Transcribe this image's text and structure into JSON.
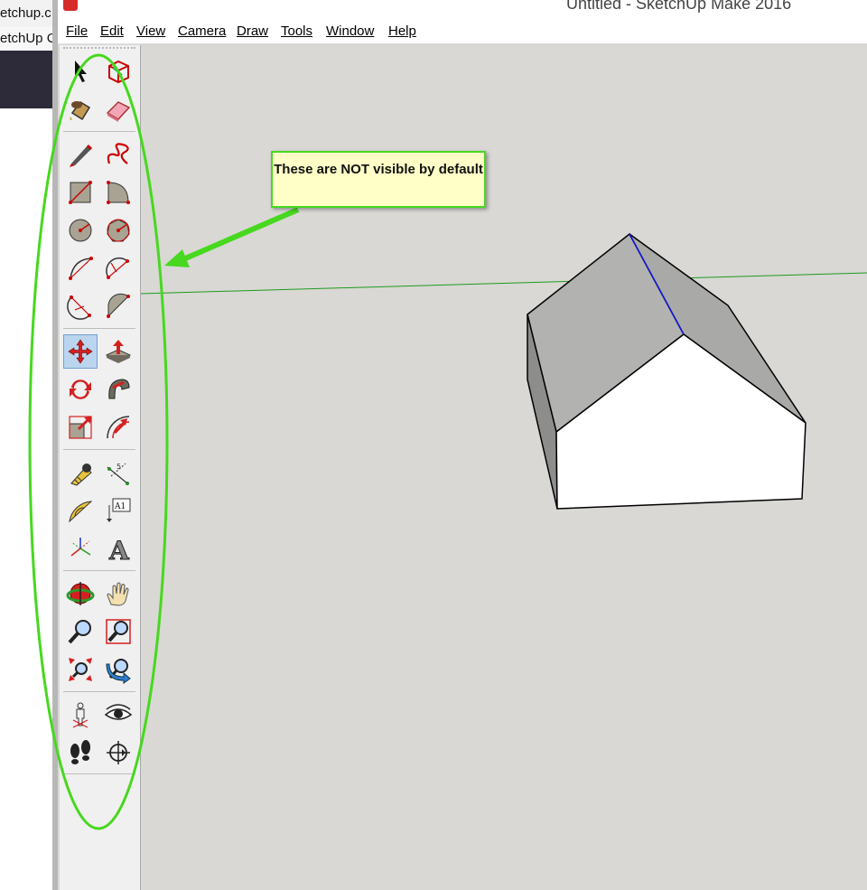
{
  "background_browser": {
    "tab_text": "etchup.c",
    "tab2_text": "etchUp C"
  },
  "window": {
    "title": "Untitled - SketchUp Make 2016"
  },
  "menu": [
    "File",
    "Edit",
    "View",
    "Camera",
    "Draw",
    "Tools",
    "Window",
    "Help"
  ],
  "toolbar": {
    "tools": [
      {
        "name": "select",
        "icon": "select-arrow-icon"
      },
      {
        "name": "make-component",
        "icon": "component-icon"
      },
      {
        "name": "paint-bucket",
        "icon": "paint-bucket-icon"
      },
      {
        "name": "eraser",
        "icon": "eraser-icon"
      },
      {
        "name": "line",
        "icon": "pencil-icon"
      },
      {
        "name": "freehand",
        "icon": "freehand-icon"
      },
      {
        "name": "rectangle",
        "icon": "rectangle-icon"
      },
      {
        "name": "rotated-rectangle",
        "icon": "rotated-rectangle-icon"
      },
      {
        "name": "circle",
        "icon": "circle-icon"
      },
      {
        "name": "polygon",
        "icon": "polygon-icon"
      },
      {
        "name": "arc",
        "icon": "arc-icon"
      },
      {
        "name": "two-point-arc",
        "icon": "two-point-arc-icon"
      },
      {
        "name": "three-point-arc",
        "icon": "three-point-arc-icon"
      },
      {
        "name": "pie",
        "icon": "pie-icon"
      },
      {
        "name": "move",
        "icon": "move-icon",
        "selected": true
      },
      {
        "name": "push-pull",
        "icon": "push-pull-icon"
      },
      {
        "name": "rotate",
        "icon": "rotate-icon"
      },
      {
        "name": "follow-me",
        "icon": "follow-me-icon"
      },
      {
        "name": "scale",
        "icon": "scale-icon"
      },
      {
        "name": "offset",
        "icon": "offset-icon"
      },
      {
        "name": "tape-measure",
        "icon": "tape-measure-icon"
      },
      {
        "name": "dimension",
        "icon": "dimension-icon"
      },
      {
        "name": "protractor",
        "icon": "protractor-icon"
      },
      {
        "name": "text",
        "icon": "text-label-icon",
        "label": "A1"
      },
      {
        "name": "axes",
        "icon": "axes-icon"
      },
      {
        "name": "3d-text",
        "icon": "3d-text-icon",
        "label": "A"
      },
      {
        "name": "orbit",
        "icon": "orbit-icon"
      },
      {
        "name": "pan",
        "icon": "pan-hand-icon"
      },
      {
        "name": "zoom",
        "icon": "zoom-icon"
      },
      {
        "name": "zoom-window",
        "icon": "zoom-window-icon"
      },
      {
        "name": "zoom-extents",
        "icon": "zoom-extents-icon"
      },
      {
        "name": "previous",
        "icon": "previous-view-icon"
      },
      {
        "name": "position-camera",
        "icon": "position-camera-icon"
      },
      {
        "name": "look-around",
        "icon": "eye-icon"
      },
      {
        "name": "walk",
        "icon": "footprints-icon"
      },
      {
        "name": "section-plane",
        "icon": "section-plane-icon"
      }
    ]
  },
  "callout": {
    "text": "These are NOT visible by default"
  },
  "colors": {
    "highlight_green": "#47d81f",
    "callout_fill": "#ffffc7",
    "viewport_bg": "#d9d8d4"
  }
}
